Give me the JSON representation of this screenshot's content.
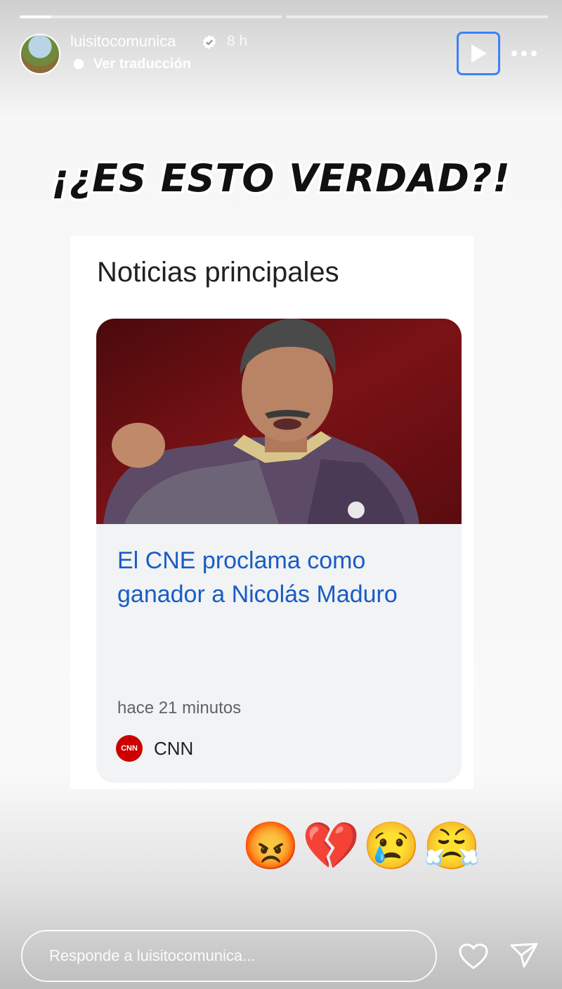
{
  "story": {
    "progress_segments": [
      0.12,
      0.0
    ],
    "username": "luisitocomunica",
    "time": "8 h",
    "translate_label": "Ver traducción",
    "icons": {
      "verified": "verified-badge-icon",
      "translate": "translate-icon",
      "play": "play-icon",
      "more": "more-options-icon"
    }
  },
  "content": {
    "headline": "¡¿ES ESTO VERDAD?!",
    "news_section_title": "Noticias principales",
    "article": {
      "headline": "El CNE proclama como ganador a Nicolás Maduro",
      "time_ago": "hace 21 minutos",
      "source_name": "CNN",
      "source_logo_text": "CNN"
    }
  },
  "reactions": [
    "😡",
    "💔",
    "😢",
    "😤"
  ],
  "reply": {
    "placeholder": "Responde a luisitocomunica...",
    "icons": {
      "like": "heart-icon",
      "send": "send-icon"
    }
  }
}
